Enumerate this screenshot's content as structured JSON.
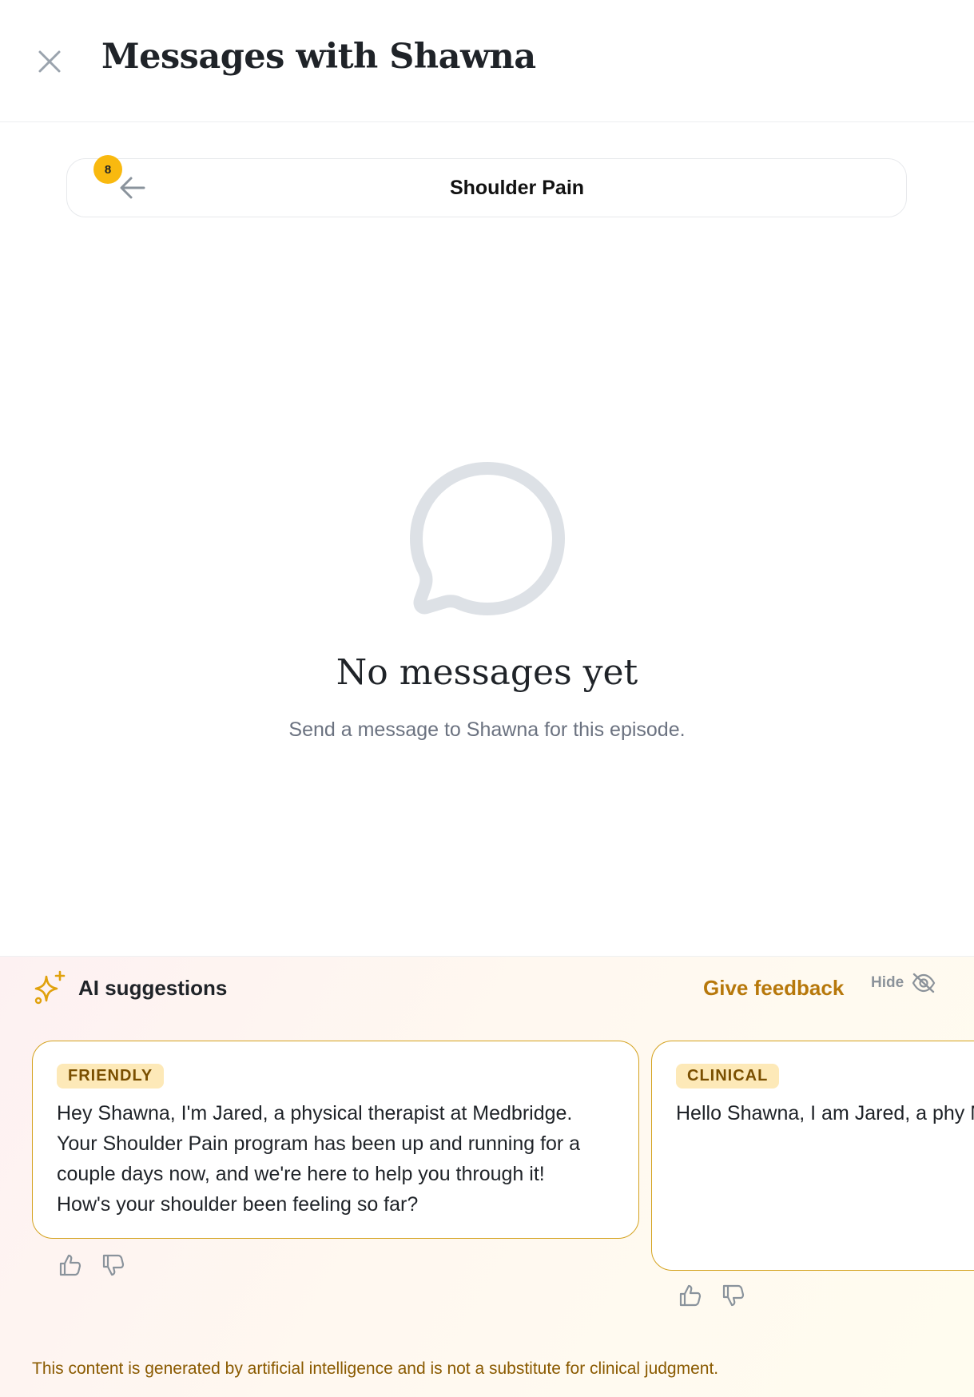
{
  "header": {
    "title": "Messages with Shawna",
    "close_icon": "close-icon"
  },
  "episode": {
    "back_icon": "arrow-left-icon",
    "badge_count": "8",
    "title": "Shoulder Pain"
  },
  "empty_state": {
    "icon": "chat-bubble-icon",
    "title": "No messages yet",
    "subtitle": "Send a message to Shawna for this episode."
  },
  "ai_suggestions": {
    "icon": "sparkle-icon",
    "title": "AI suggestions",
    "feedback_label": "Give feedback",
    "hide_label": "Hide",
    "hide_icon": "eye-off-icon",
    "cards": [
      {
        "tag": "FRIENDLY",
        "text": "Hey Shawna, I'm Jared, a physical therapist at Medbridge.\nYour Shoulder Pain program has been up and running for a\ncouple days now, and we're here to help you through it!\nHow's your shoulder been feeling so far?"
      },
      {
        "tag": "CLINICAL",
        "text": "Hello Shawna, I am Jared, a phy\nMedbridge. Your Shoulder Pain \nfor a couple of days, and your c\nyou as you get started. How are\nthere anything we can help with"
      }
    ],
    "rating_icons": [
      "thumbs-up-icon",
      "thumbs-down-icon"
    ],
    "disclaimer": "This content is generated by artificial intelligence and is not a substitute for clinical judgment."
  },
  "colors": {
    "accent": "#f9b90f",
    "feedback": "#b7780b",
    "card_border": "#d4a21e",
    "tag_bg": "#fde9b8",
    "muted": "#6b7280"
  }
}
